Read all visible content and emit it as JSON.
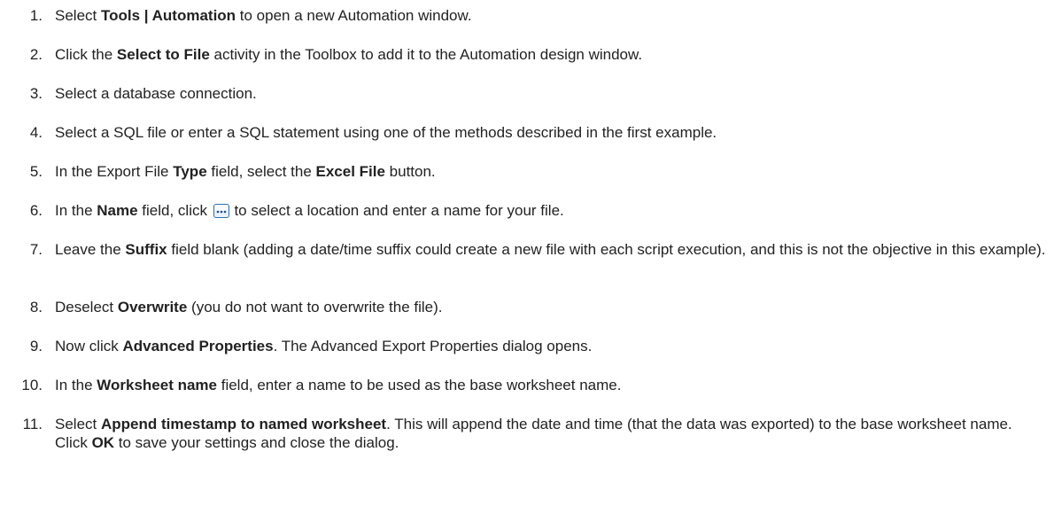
{
  "steps": [
    {
      "num": "1.",
      "parts": [
        "Select ",
        "Tools | Automation",
        " to open a new Automation window."
      ]
    },
    {
      "num": "2.",
      "parts": [
        "Click the ",
        "Select to File",
        " activity in the Toolbox to add it to the Automation design window."
      ]
    },
    {
      "num": "3.",
      "parts": [
        "Select a database connection."
      ]
    },
    {
      "num": "4.",
      "parts": [
        "Select a SQL file or enter a SQL statement using one of the methods described in the first example."
      ]
    },
    {
      "num": "5.",
      "parts": [
        "In the Export File ",
        "Type",
        " field, select the ",
        "Excel File",
        " button."
      ]
    },
    {
      "num": "6.",
      "parts": [
        "In the ",
        "Name",
        " field, click ",
        " to select a location and enter a name for your file."
      ]
    },
    {
      "num": "7.",
      "parts": [
        "Leave the ",
        "Suffix",
        " field blank (adding a date/time suffix could create a new file with each script execution, and this is not the objective in this example)."
      ]
    },
    {
      "num": "8.",
      "parts": [
        "Deselect ",
        "Overwrite",
        " (you do not want to overwrite the file)."
      ]
    },
    {
      "num": "9.",
      "parts": [
        "Now click ",
        "Advanced Properties",
        ". The Advanced Export Properties dialog opens."
      ]
    },
    {
      "num": "10.",
      "parts": [
        "In the ",
        "Worksheet name",
        " field, enter a name to be used as the base worksheet name."
      ]
    },
    {
      "num": "11.",
      "parts": [
        "Select ",
        "Append timestamp to named worksheet",
        ". This will append the date and time (that the data was exported) to the base worksheet name. Click ",
        "OK",
        " to save your settings and close the dialog."
      ]
    }
  ],
  "icons": {
    "browse_icon": "ellipsis-browse-icon",
    "browse_icon_color": "#2f6fb5"
  }
}
